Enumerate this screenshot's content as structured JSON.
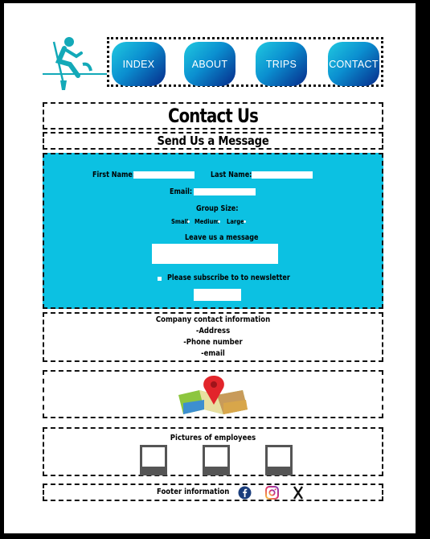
{
  "nav": {
    "items": [
      {
        "label": "INDEX"
      },
      {
        "label": "ABOUT"
      },
      {
        "label": "TRIPS"
      },
      {
        "label": "CONTACT"
      }
    ]
  },
  "page": {
    "title": "Contact Us",
    "subtitle": "Send Us a Message"
  },
  "form": {
    "first_name_label": "First Name:",
    "first_name_value": "",
    "last_name_label": "Last Name:",
    "last_name_value": "",
    "email_label": "Email:",
    "email_value": "",
    "group_size_label": "Group Size:",
    "group_options": [
      "Small",
      "Medium",
      "Large"
    ],
    "message_label": "Leave us a message",
    "message_value": "",
    "subscribe_label": "Please subscribe to to newsletter",
    "subscribe_checked": false,
    "submit_label": ""
  },
  "contact_info": {
    "lines": [
      "Company contact information",
      "-Address",
      "-Phone number",
      "-email"
    ]
  },
  "employees": {
    "title": "Pictures of employees"
  },
  "footer": {
    "text": "Footer information",
    "icons": [
      "facebook-icon",
      "instagram-icon",
      "x-icon"
    ]
  },
  "colors": {
    "form_background": "#0cc1e2",
    "logo": "#13a9b8",
    "nav_gradient_start": "#20c9e0",
    "nav_gradient_end": "#062a8a"
  }
}
